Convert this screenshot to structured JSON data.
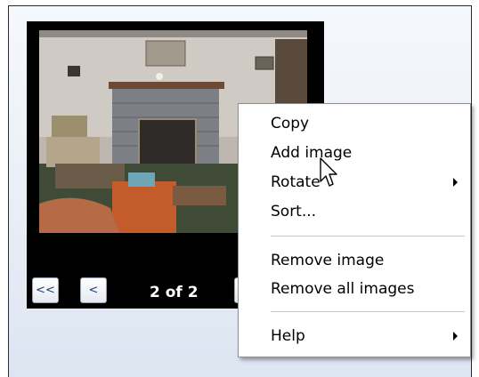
{
  "viewer": {
    "prev_all_label": "<<",
    "prev_label": "<",
    "counter": "2 of 2"
  },
  "context_menu": {
    "items": [
      {
        "label": "Copy"
      },
      {
        "label": "Add image"
      },
      {
        "label": "Rotate",
        "submenu": true
      },
      {
        "label": "Sort..."
      },
      {
        "label": "Remove image"
      },
      {
        "label": "Remove all images"
      },
      {
        "label": "Help",
        "submenu": true
      }
    ]
  },
  "icons": [
    "arrow-cursor-icon",
    "submenu-arrow-icon"
  ],
  "colors": {
    "viewer_bg": "#000000",
    "nav_text": "#1b3c78",
    "menu_bg": "#ffffff",
    "separator": "#c8c8c8"
  }
}
